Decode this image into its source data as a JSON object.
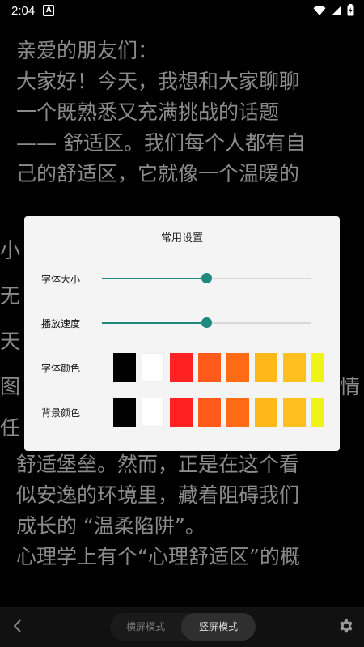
{
  "status_bar": {
    "time": "2:04",
    "notification_glyph": "A",
    "icons": [
      "wifi-icon",
      "signal-icon",
      "battery-charging-icon"
    ]
  },
  "reader": {
    "lines_top": [
      "亲爱的朋友们：",
      "大家好！今天，我想和大家聊聊",
      "一个既熟悉又充满挑战的话题",
      "—— 舒适区。我们每个人都有自",
      "己的舒适区，它就像一个温暖的"
    ],
    "peek_left": [
      "小",
      "无",
      "天",
      "图",
      "任"
    ],
    "peek_right": [
      "情"
    ],
    "lines_bottom": [
      "舒适堡垒。然而，正是在这个看",
      "似安逸的环境里，藏着阻碍我们",
      "成长的 “温柔陷阱”。",
      "心理学上有个“心理舒适区”的概"
    ]
  },
  "dialog": {
    "title": "常用设置",
    "font_size": {
      "label": "字体大小",
      "value": 0.5
    },
    "play_speed": {
      "label": "播放速度",
      "value": 0.5
    },
    "font_color": {
      "label": "字体颜色",
      "swatches": [
        "#000000",
        "#ffffff",
        "#ff2222",
        "#ff5a1a",
        "#ff6a14",
        "#ffb81a",
        "#ffbf1e",
        "#eef516",
        "#f0f51c"
      ]
    },
    "bg_color": {
      "label": "背景颜色",
      "swatches": [
        "#000000",
        "#ffffff",
        "#ff2222",
        "#ff5a1a",
        "#ff6a14",
        "#ffb81a",
        "#ffbf1e",
        "#eef516",
        "#f0f51c"
      ]
    },
    "accent_color": "#1f8a7c"
  },
  "bottom_bar": {
    "landscape_label": "横屏模式",
    "portrait_label": "竖屏模式",
    "selected": "portrait"
  }
}
